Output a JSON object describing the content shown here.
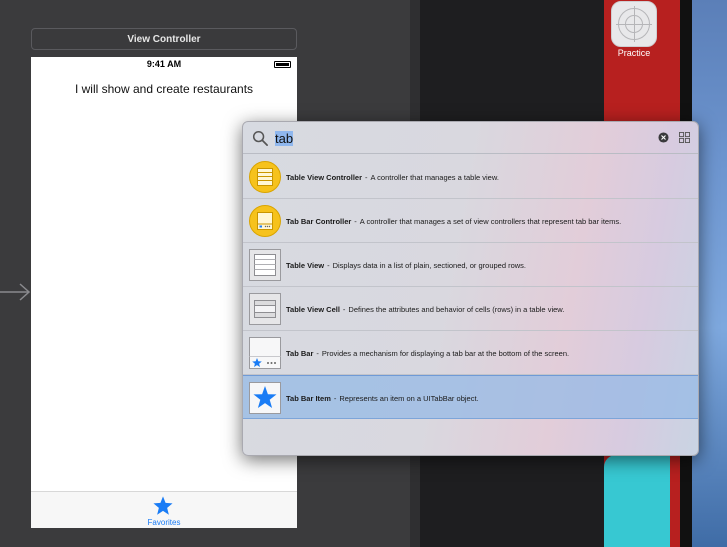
{
  "canvas": {
    "view_controller_title": "View Controller",
    "status_time": "9:41 AM",
    "phone_label": "I will show and create restaurants",
    "tab_item_label": "Favorites"
  },
  "device": {
    "app_label": "Practice"
  },
  "library": {
    "search_value": "tab",
    "items": [
      {
        "title": "Table View Controller",
        "description": "A controller that manages a table view.",
        "icon": "table-view-controller-icon"
      },
      {
        "title": "Tab Bar Controller",
        "description": "A controller that manages a set of view controllers that represent tab bar items.",
        "icon": "tab-bar-controller-icon"
      },
      {
        "title": "Table View",
        "description": "Displays data in a list of plain, sectioned, or grouped rows.",
        "icon": "table-view-icon"
      },
      {
        "title": "Table View Cell",
        "description": "Defines the attributes and behavior of cells (rows) in a table view.",
        "icon": "table-view-cell-icon"
      },
      {
        "title": "Tab Bar",
        "description": "Provides a mechanism for displaying a tab bar at the bottom of the screen.",
        "icon": "tab-bar-icon"
      },
      {
        "title": "Tab Bar Item",
        "description": "Represents an item on a UITabBar object.",
        "icon": "tab-bar-item-icon",
        "selected": true
      }
    ]
  },
  "colors": {
    "accent_blue": "#1a7cf5",
    "library_yellow": "#f6c21c",
    "selection": "#96b9e6"
  }
}
